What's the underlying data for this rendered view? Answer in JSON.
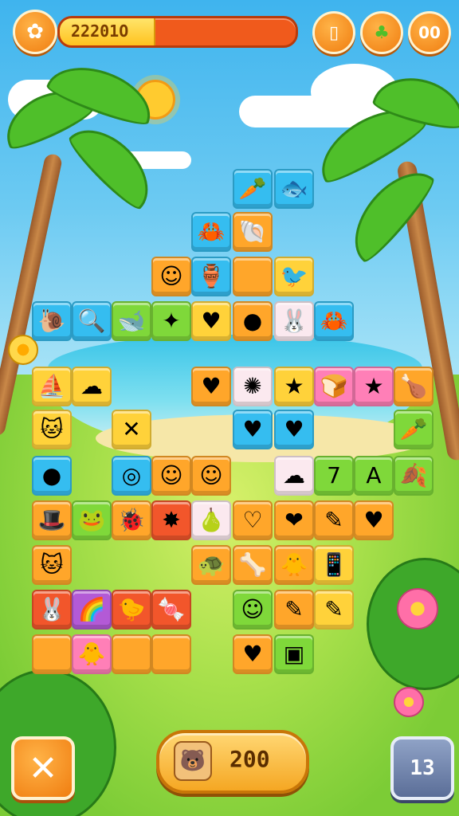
{
  "hud": {
    "menu_icon": "flower-icon",
    "progress_label": "22201О",
    "progress_fraction": 0.4,
    "book_icon": "book-icon",
    "leaf_icon": "leaf-icon",
    "top_counter": "00"
  },
  "footer": {
    "close_icon": "close-icon",
    "score_icon": "bear-icon",
    "score_value": "200",
    "level_label": "13"
  },
  "colors": {
    "orange": "#ffa62a",
    "yellow": "#ffd23a",
    "blue": "#35bdf0",
    "green": "#7fd83a",
    "pink": "#ff7fb7",
    "red": "#f2562b"
  },
  "tiles": [
    {
      "name": "carrot-tile",
      "glyph": "🥕",
      "color": "c-blue"
    },
    {
      "name": "fish-tile",
      "glyph": "🐟",
      "color": "c-blue"
    },
    {
      "name": "crab-tile",
      "glyph": "🦀",
      "color": "c-blue"
    },
    {
      "name": "shell-tile",
      "glyph": "🐚",
      "color": "c-orange"
    },
    {
      "name": "smiley-tile",
      "glyph": "☺",
      "color": "c-orange"
    },
    {
      "name": "vase-tile",
      "glyph": "🏺",
      "color": "c-blue"
    },
    {
      "name": "blank-tile",
      "glyph": "",
      "color": "c-orange"
    },
    {
      "name": "bird-tile",
      "glyph": "🐦",
      "color": "c-yellow"
    },
    {
      "name": "snail-tile",
      "glyph": "🐌",
      "color": "c-blue"
    },
    {
      "name": "magnifier-tile",
      "glyph": "🔍",
      "color": "c-blue"
    },
    {
      "name": "whale-tile",
      "glyph": "🐋",
      "color": "c-green"
    },
    {
      "name": "starfish-tile",
      "glyph": "✦",
      "color": "c-green"
    },
    {
      "name": "heart-tile",
      "glyph": "♥",
      "color": "c-yellow"
    },
    {
      "name": "tomato-tile",
      "glyph": "●",
      "color": "c-orange"
    },
    {
      "name": "bunny-tile",
      "glyph": "🐰",
      "color": "c-white"
    },
    {
      "name": "crab2-tile",
      "glyph": "🦀",
      "color": "c-blue"
    },
    {
      "name": "ship-tile",
      "glyph": "⛵",
      "color": "c-yellow"
    },
    {
      "name": "sponge-tile",
      "glyph": "☁",
      "color": "c-yellow"
    },
    {
      "name": "heart2-tile",
      "glyph": "♥",
      "color": "c-orange"
    },
    {
      "name": "splat-tile",
      "glyph": "✺",
      "color": "c-white"
    },
    {
      "name": "star-tile",
      "glyph": "★",
      "color": "c-yellow"
    },
    {
      "name": "bread-tile",
      "glyph": "🍞",
      "color": "c-pink"
    },
    {
      "name": "star2-tile",
      "glyph": "★",
      "color": "c-pink"
    },
    {
      "name": "drumstick-tile",
      "glyph": "🍗",
      "color": "c-orange"
    },
    {
      "name": "cat-tile",
      "glyph": "🐱",
      "color": "c-yellow"
    },
    {
      "name": "bone-tile",
      "glyph": "✕",
      "color": "c-yellow"
    },
    {
      "name": "red-heart-tile",
      "glyph": "♥",
      "color": "c-blue"
    },
    {
      "name": "pink-heart-tile",
      "glyph": "♥",
      "color": "c-blue"
    },
    {
      "name": "carrot2-tile",
      "glyph": "🥕",
      "color": "c-green"
    },
    {
      "name": "berry-tile",
      "glyph": "●",
      "color": "c-blue"
    },
    {
      "name": "sundial-tile",
      "glyph": "◎",
      "color": "c-blue"
    },
    {
      "name": "face-tile",
      "glyph": "☺",
      "color": "c-orange"
    },
    {
      "name": "orange-face-tile",
      "glyph": "☺",
      "color": "c-orange"
    },
    {
      "name": "cloud-tile",
      "glyph": "☁",
      "color": "c-white"
    },
    {
      "name": "seven-tile",
      "glyph": "7",
      "color": "c-green"
    },
    {
      "name": "letter-a-tile",
      "glyph": "A",
      "color": "c-green"
    },
    {
      "name": "leaf-tile",
      "glyph": "🍂",
      "color": "c-green"
    },
    {
      "name": "hat-tile",
      "glyph": "🎩",
      "color": "c-orange"
    },
    {
      "name": "frog-tile",
      "glyph": "🐸",
      "color": "c-green"
    },
    {
      "name": "bug-tile",
      "glyph": "🐞",
      "color": "c-orange"
    },
    {
      "name": "magenta-star-tile",
      "glyph": "✸",
      "color": "c-red"
    },
    {
      "name": "pear-tile",
      "glyph": "🍐",
      "color": "c-white"
    },
    {
      "name": "heart3-tile",
      "glyph": "♡",
      "color": "c-orange"
    },
    {
      "name": "chevron-tile",
      "glyph": "❤",
      "color": "c-orange"
    },
    {
      "name": "pencil-tile",
      "glyph": "✎",
      "color": "c-orange"
    },
    {
      "name": "heart4-tile",
      "glyph": "♥",
      "color": "c-orange"
    },
    {
      "name": "white-cat-tile",
      "glyph": "🐱",
      "color": "c-orange"
    },
    {
      "name": "turtle-tile",
      "glyph": "🐢",
      "color": "c-orange"
    },
    {
      "name": "stick-tile",
      "glyph": "🦴",
      "color": "c-orange"
    },
    {
      "name": "duck-tile",
      "glyph": "🐥",
      "color": "c-orange"
    },
    {
      "name": "phone-tile",
      "glyph": "📱",
      "color": "c-yellow"
    },
    {
      "name": "rabbit-tile",
      "glyph": "🐰",
      "color": "c-red"
    },
    {
      "name": "rainbow-tile",
      "glyph": "🌈",
      "color": "c-purple"
    },
    {
      "name": "bird2-tile",
      "glyph": "🐤",
      "color": "c-red"
    },
    {
      "name": "candy-tile",
      "glyph": "🍬",
      "color": "c-red"
    },
    {
      "name": "slime-tile",
      "glyph": "☺",
      "color": "c-green"
    },
    {
      "name": "pencil2-tile",
      "glyph": "✎",
      "color": "c-orange"
    },
    {
      "name": "pencil3-tile",
      "glyph": "✎",
      "color": "c-yellow"
    },
    {
      "name": "blank2-tile",
      "glyph": "",
      "color": "c-orange"
    },
    {
      "name": "chick-tile",
      "glyph": "🐥",
      "color": "c-pink"
    },
    {
      "name": "blank3-tile",
      "glyph": "",
      "color": "c-orange"
    },
    {
      "name": "blank4-tile",
      "glyph": "",
      "color": "c-orange"
    },
    {
      "name": "heart5-tile",
      "glyph": "♥",
      "color": "c-orange"
    },
    {
      "name": "window-tile",
      "glyph": "▣",
      "color": "c-green"
    }
  ]
}
